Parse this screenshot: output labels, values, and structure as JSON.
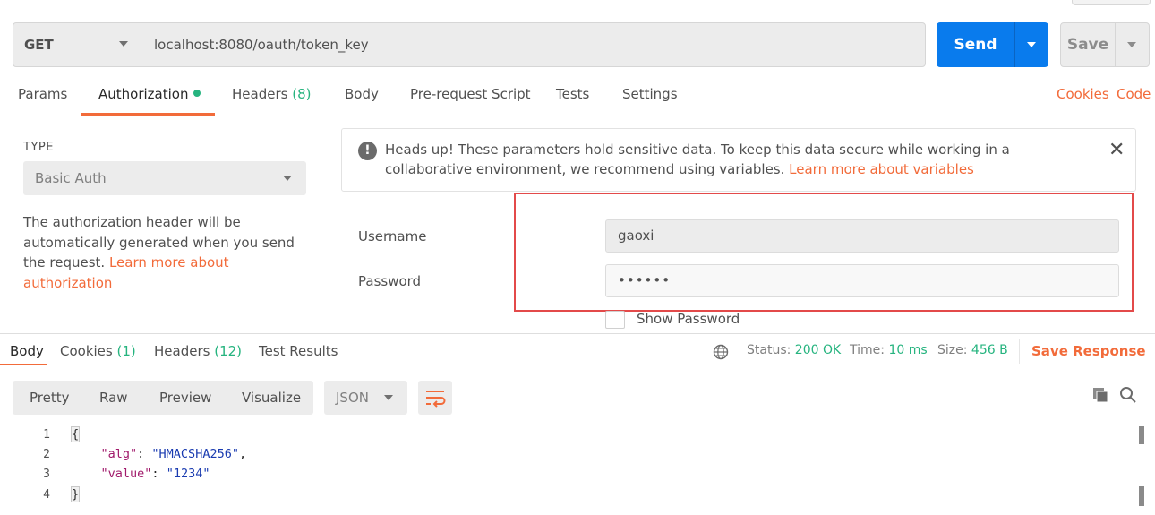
{
  "request": {
    "method": "GET",
    "url": "localhost:8080/oauth/token_key",
    "send_label": "Send",
    "save_label": "Save"
  },
  "request_tabs": {
    "params": "Params",
    "authorization": "Authorization",
    "headers": "Headers",
    "headers_count": "(8)",
    "body": "Body",
    "prerequest": "Pre-request Script",
    "tests": "Tests",
    "settings": "Settings",
    "cookies": "Cookies",
    "code": "Code"
  },
  "auth": {
    "type_label": "TYPE",
    "type_value": "Basic Auth",
    "description": "The authorization header will be automatically generated when you send the request.",
    "learn_more": "Learn more about authorization"
  },
  "warning": {
    "text": "Heads up! These parameters hold sensitive data. To keep this data secure while working in a collaborative environment, we recommend using variables.",
    "link": "Learn more about variables"
  },
  "credentials": {
    "username_label": "Username",
    "username_value": "gaoxi",
    "password_label": "Password",
    "password_value": "••••••",
    "show_password": "Show Password"
  },
  "response_tabs": {
    "body": "Body",
    "cookies": "Cookies",
    "cookies_count": "(1)",
    "headers": "Headers",
    "headers_count": "(12)",
    "test_results": "Test Results"
  },
  "response_meta": {
    "status_label": "Status:",
    "status_value": "200 OK",
    "time_label": "Time:",
    "time_value": "10 ms",
    "size_label": "Size:",
    "size_value": "456 B",
    "save_response": "Save Response"
  },
  "view_options": {
    "pretty": "Pretty",
    "raw": "Raw",
    "preview": "Preview",
    "visualize": "Visualize",
    "format": "JSON"
  },
  "code": {
    "lines": [
      "1",
      "2",
      "3",
      "4"
    ],
    "open": "{",
    "close": "}",
    "k1": "\"alg\"",
    "v1": "\"HMACSHA256\"",
    "k2": "\"value\"",
    "v2": "\"1234\""
  },
  "colors": {
    "accent": "#f26b3a",
    "send_blue": "#097bed",
    "success_green": "#26b47f",
    "highlight_red": "#e34a4a"
  }
}
